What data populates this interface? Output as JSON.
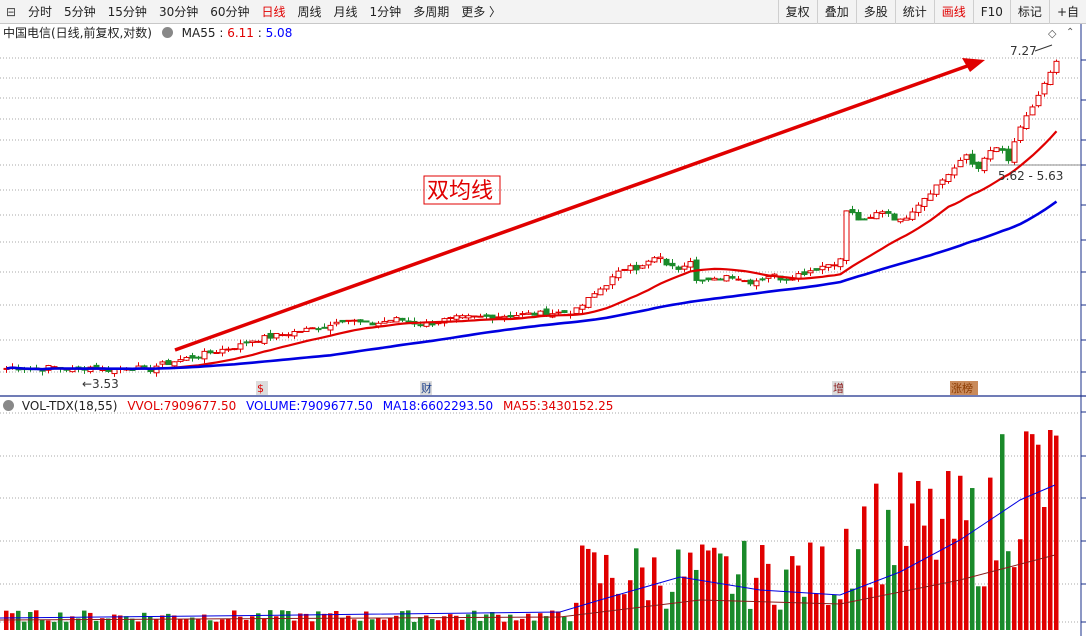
{
  "toolbar": {
    "left": [
      {
        "label": "分时",
        "active": false
      },
      {
        "label": "5分钟",
        "active": false
      },
      {
        "label": "15分钟",
        "active": false
      },
      {
        "label": "30分钟",
        "active": false
      },
      {
        "label": "60分钟",
        "active": false
      },
      {
        "label": "日线",
        "active": true
      },
      {
        "label": "周线",
        "active": false
      },
      {
        "label": "月线",
        "active": false
      },
      {
        "label": "1分钟",
        "active": false
      },
      {
        "label": "多周期",
        "active": false
      },
      {
        "label": "更多 〉",
        "active": false
      }
    ],
    "right": [
      {
        "label": "复权",
        "active": false
      },
      {
        "label": "叠加",
        "active": false
      },
      {
        "label": "多股",
        "active": false
      },
      {
        "label": "统计",
        "active": false
      },
      {
        "label": "画线",
        "active": true
      },
      {
        "label": "F10",
        "active": false
      },
      {
        "label": "标记",
        "active": false
      },
      {
        "label": "+自",
        "active": false
      }
    ]
  },
  "info": {
    "title": "中国电信(日线,前复权,对数)",
    "ma_name": "MA55",
    "ma_sep": ":",
    "ma_val1": "6.11",
    "ma_val2": "5.08"
  },
  "annotation": {
    "text": "双均线",
    "color": "#e00000"
  },
  "price_labels": {
    "high": "7.27",
    "low": "3.53",
    "mid": "5.62 - 5.63"
  },
  "event_markers": [
    {
      "label": "$",
      "color": "#e00000"
    },
    {
      "label": "财",
      "color": "#1a3e8a"
    },
    {
      "label": "增",
      "color": "#8b1a1a"
    },
    {
      "label": "涨榜",
      "color": "#8b3a00"
    }
  ],
  "volume": {
    "name": "VOL-TDX(18,55)",
    "vvol_label": "VVOL:",
    "vvol": "7909677.50",
    "volume_label": "VOLUME:",
    "volume": "7909677.50",
    "ma18_label": "MA18:",
    "ma18": "6602293.50",
    "ma55_label": "MA55:",
    "ma55": "3430152.25"
  },
  "colors": {
    "up": "#e00000",
    "down": "#1a8a2a",
    "ma_short": "#e00000",
    "ma_long": "#0000e0",
    "grid": "#808080"
  },
  "icons": {
    "collapse": "collapse-icon",
    "settings": "gear-icon",
    "diamond": "diamond-icon"
  }
}
